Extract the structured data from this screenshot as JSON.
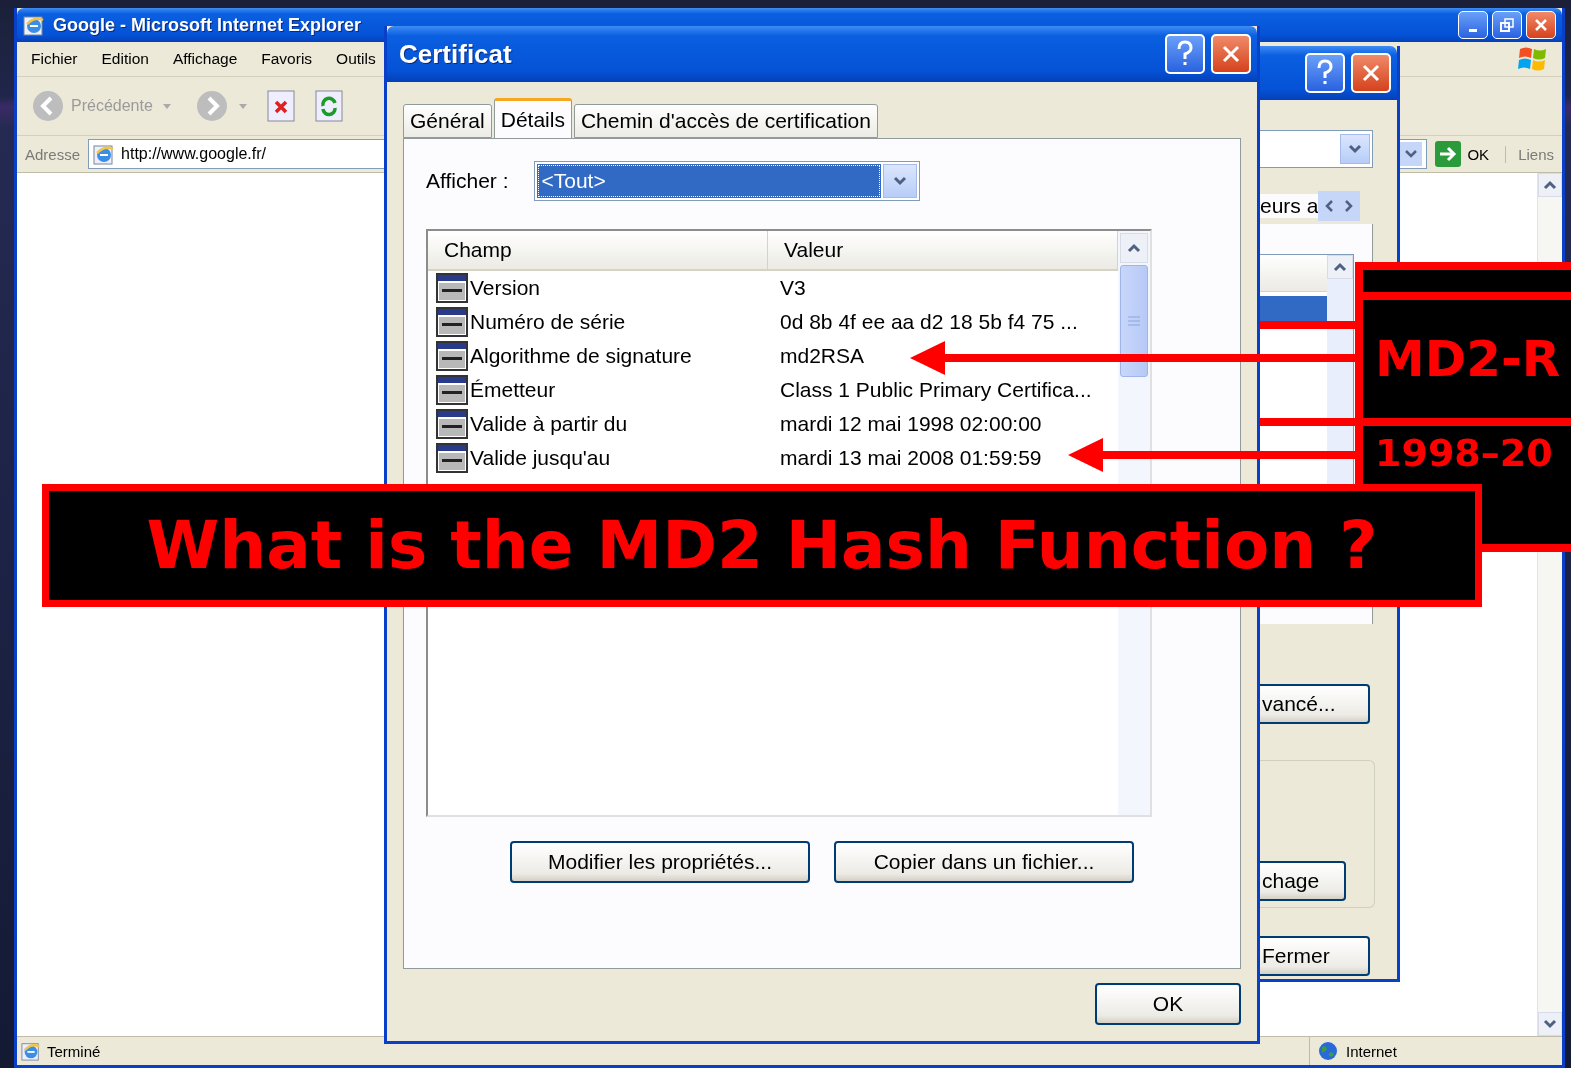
{
  "browser": {
    "title": "Google - Microsoft Internet Explorer",
    "menu": [
      "Fichier",
      "Edition",
      "Affichage",
      "Favoris",
      "Outils"
    ],
    "back": {
      "label": "Précédente",
      "disabled": true
    },
    "address": {
      "label": "Adresse",
      "url": "http://www.google.fr/"
    },
    "go_label": "OK",
    "links_label": "Liens",
    "status_bar": {
      "text": "Terminé",
      "zone": "Internet"
    }
  },
  "background_dialog": {
    "tab_fragment": "eurs a",
    "buttons": [
      "vancé...",
      "chage",
      "Fermer"
    ]
  },
  "certificate_dialog": {
    "title": "Certificat",
    "tabs": [
      {
        "label": "Général",
        "selected": false
      },
      {
        "label": "Détails",
        "selected": true
      },
      {
        "label": "Chemin d'accès de certification",
        "selected": false
      }
    ],
    "show_label": "Afficher :",
    "show_value": "<Tout>",
    "columns": [
      "Champ",
      "Valeur"
    ],
    "rows": [
      {
        "field": "Version",
        "value": "V3"
      },
      {
        "field": "Numéro de série",
        "value": "0d 8b 4f ee aa d2 18 5b f4 75 ..."
      },
      {
        "field": "Algorithme de signature",
        "value": "md2RSA"
      },
      {
        "field": "Émetteur",
        "value": "Class 1 Public Primary Certifica..."
      },
      {
        "field": "Valide à partir du",
        "value": "mardi 12 mai 1998 02:00:00"
      },
      {
        "field": "Valide jusqu'au",
        "value": "mardi 13 mai 2008 01:59:59"
      }
    ],
    "buttons": [
      "Modifier les propriétés...",
      "Copier dans un fichier..."
    ],
    "ok": "OK"
  },
  "annotation": {
    "question": "What is the MD2 Hash Function ?",
    "callouts": [
      "MD2-R",
      "1998–20"
    ]
  }
}
